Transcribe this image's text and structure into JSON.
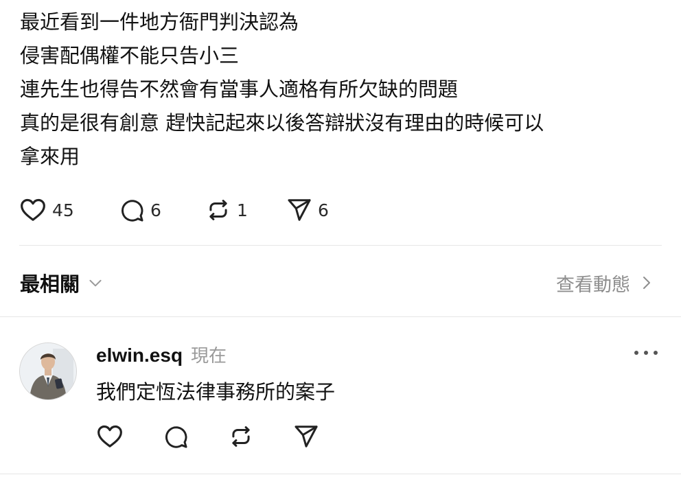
{
  "post": {
    "lines": [
      "最近看到一件地方衙門判決認為",
      "侵害配偶權不能只告小三",
      "連先生也得告不然會有當事人適格有所欠缺的問題",
      "真的是很有創意  趕快記起來以後答辯狀沒有理由的時候可以",
      "拿來用"
    ],
    "stats": {
      "likes": "45",
      "replies": "6",
      "reposts": "1",
      "shares": "6"
    }
  },
  "sort": {
    "label": "最相關",
    "activity_label": "查看動態"
  },
  "reply": {
    "username": "elwin.esq",
    "timestamp": "現在",
    "text": "我們定恆法律事務所的案子"
  },
  "icons": {
    "like": "heart-icon",
    "reply": "comment-icon",
    "repost": "repost-icon",
    "share": "send-icon",
    "sort_caret": "chevron-down-icon",
    "activity_caret": "chevron-right-icon",
    "more": "more-icon"
  },
  "colors": {
    "text": "#111111",
    "muted": "#8e8e8e",
    "divider": "#e6e6e6",
    "background": "#ffffff"
  }
}
